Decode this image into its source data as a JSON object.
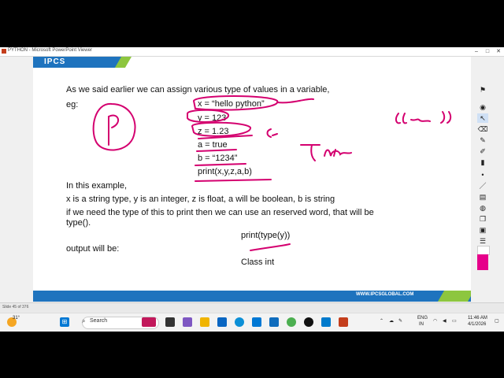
{
  "window": {
    "title": "PYTHON - Microsoft PowerPoint Viewer",
    "min": "–",
    "max": "□",
    "close": "✕"
  },
  "slide": {
    "logo": "IPCS",
    "footer_url": "WWW.IPCSGLOBAL.COM",
    "intro": "As we said earlier we can assign various type of values in a variable,",
    "eg": "eg:",
    "code_lines": [
      "x = “hello python”",
      "y = 123",
      "z = 1.23",
      "a = true",
      "b = “1234”",
      "print(x,y,z,a,b)"
    ],
    "in_example": "In this example,",
    "explain": "x is a string type, y is an integer, z is float, a will be boolean, b is string",
    "need1": "if we need the type of this to print then we can use an reserved word, that will be",
    "need2": "type().",
    "print_type": "print(type(y))",
    "output_label": "output will be:",
    "class_int": "Class int"
  },
  "annotations": {
    "color": "#d4006f"
  },
  "status": {
    "slide_counter": "Slide 45 of 376"
  },
  "taskbar": {
    "weather": "31°",
    "search_label": "Search",
    "lang_line1": "ENG",
    "lang_line2": "IN",
    "time": "11:46 AM",
    "date": "4/1/2026"
  },
  "colors": {
    "brand_blue": "#1e73be",
    "brand_green": "#8dc63f",
    "pen": "#d4006f"
  }
}
